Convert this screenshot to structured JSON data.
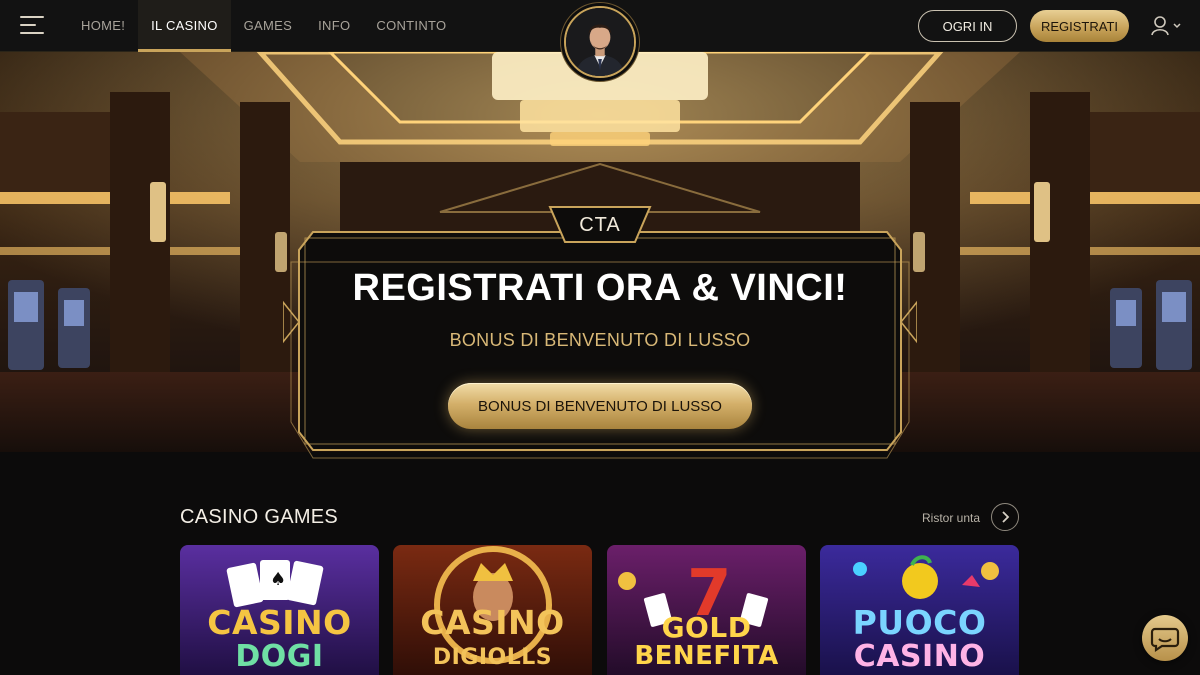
{
  "nav": {
    "links": [
      {
        "label": "HOME!",
        "active": false
      },
      {
        "label": "IL CASINO",
        "active": true
      },
      {
        "label": "GAMES",
        "active": false
      },
      {
        "label": "INFO",
        "active": false
      },
      {
        "label": "CONTINTO",
        "active": false
      }
    ],
    "login_label": "OGRI IN",
    "register_label": "REGISTRATI",
    "icons": {
      "menu": "hamburger-icon",
      "avatar": "host-avatar",
      "user": "user-icon",
      "dropdown": "chevron-down-icon"
    }
  },
  "hero": {
    "tag": "CTA",
    "title": "REGISTRATI ORA & VINCI!",
    "subtitle": "BONUS DI BENVENUTO DI LUSSO",
    "button_label": "BONUS DI BENVENUTO DI LUSSO"
  },
  "games": {
    "title": "CASINO GAMES",
    "see_all_label": "Ristor unta",
    "cards": [
      {
        "line1": "CASINO",
        "line2": "DOGI",
        "color1": "#f5c542",
        "color2": "#6fe0a4"
      },
      {
        "line1": "CASINO",
        "line2": "DIGIOLLS",
        "color1": "#f3c35a",
        "color2": "#f3c35a"
      },
      {
        "line1": "GOLD",
        "line2": "BENEFITA",
        "color1": "#ffd54a",
        "color2": "#ffd54a"
      },
      {
        "line1": "PUOCO",
        "line2": "CASINO",
        "color1": "#7ad4ff",
        "color2": "#ffb3e6"
      }
    ]
  },
  "chat": {
    "icon": "chat-bubble-icon"
  },
  "colors": {
    "gold": "#c9a45b",
    "background": "#0c0b0b",
    "text_gold": "#d8b877"
  }
}
